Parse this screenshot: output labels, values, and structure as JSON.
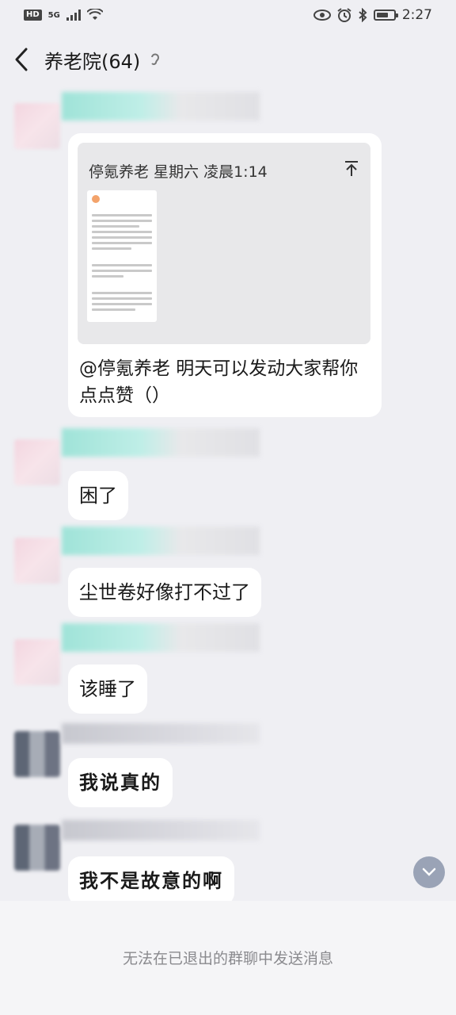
{
  "status_bar": {
    "hd_label": "HD",
    "network_label": "5G",
    "time": "2:27",
    "icons": [
      "hd-icon",
      "signal-icon",
      "wifi-icon",
      "eye-icon",
      "alarm-icon",
      "bluetooth-icon",
      "battery-icon"
    ]
  },
  "header": {
    "title": "养老院(64)",
    "icons": [
      "back-icon",
      "earpiece-icon"
    ]
  },
  "messages": [
    {
      "type": "quote-card",
      "quote_header": "停氪养老  星期六 凌晨1:14",
      "text": "@停氪养老 明天可以发动大家帮你点点赞（）"
    },
    {
      "type": "text",
      "text": "困了"
    },
    {
      "type": "text",
      "text": "尘世卷好像打不过了"
    },
    {
      "type": "text",
      "text": "该睡了"
    },
    {
      "type": "text",
      "text": "我说真的"
    },
    {
      "type": "text",
      "text": "我不是故意的啊"
    }
  ],
  "footer": {
    "notice": "无法在已退出的群聊中发送消息"
  },
  "colors": {
    "background": "#efeff3",
    "bubble": "#ffffff",
    "scroll_button": "#9aa3b6",
    "footer_text": "#8a8a8e"
  }
}
